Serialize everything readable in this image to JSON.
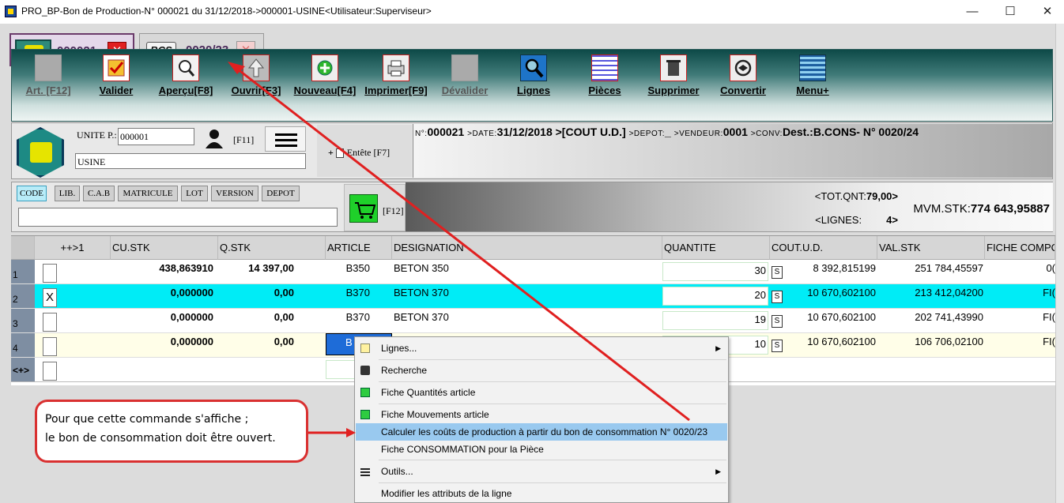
{
  "window": {
    "title": "PRO_BP-Bon de Production-N° 000021 du 31/12/2018->000001-USINE<Utilisateur:Superviseur>",
    "minimize": "—",
    "maximize": "☐",
    "close": "✕"
  },
  "doc_tabs": [
    {
      "label": "000021",
      "icon": "pro-logo-icon",
      "close": "✕"
    },
    {
      "label": "0020/23",
      "icon_text": "BCS",
      "close": "✕"
    }
  ],
  "toolbar": {
    "buttons": [
      {
        "label": "Art. [F12]",
        "icon": "blank-square-icon",
        "disabled": true
      },
      {
        "label": "Valider",
        "icon": "checkmark-icon"
      },
      {
        "label": "Aperçu[F8]",
        "icon": "magnifier-icon"
      },
      {
        "label": "Ouvrir[F3]",
        "icon": "up-arrow-icon"
      },
      {
        "label": "Nouveau[F4]",
        "icon": "plus-icon"
      },
      {
        "label": "Imprimer[F9]",
        "icon": "printer-icon"
      },
      {
        "label": "Dévalider",
        "icon": "blank-square-icon",
        "disabled": true
      },
      {
        "label": "Lignes",
        "icon": "search-lines-icon"
      },
      {
        "label": "Pièces",
        "icon": "grid-icon"
      },
      {
        "label": "Supprimer",
        "icon": "trash-icon"
      },
      {
        "label": "Convertir",
        "icon": "convert-icon"
      },
      {
        "label": "Menu+",
        "icon": "menu-lines-icon"
      }
    ]
  },
  "header": {
    "unite_label": "UNITE P.:",
    "unite_value": "000001",
    "usine_value": "USINE",
    "f11_label": "[F11]",
    "entete_label": "Entête [F7]",
    "doc_line": {
      "n_label": "N°:",
      "n_value": "000021",
      "date_label": ">DATE:",
      "date_value": "31/12/2018",
      "cout_value": ">[COUT U.D.]",
      "depot_label": ">DEPOT:",
      "depot_value": "_",
      "vendeur_label": ">VENDEUR:",
      "vendeur_value": "0001",
      "conv_label": ">CONV:",
      "conv_value": "Dest.:B.CONS- N° 0020/24"
    }
  },
  "search": {
    "tabs": [
      "CODE",
      "LIB.",
      "C.A.B",
      "MATRICULE",
      "LOT",
      "VERSION",
      "DEPOT"
    ],
    "active_tab": "CODE",
    "value": "",
    "cart_label": "[F12]"
  },
  "totals": {
    "tot_qnt_label": "<TOT.QNT:",
    "tot_qnt_value": "79,00>",
    "lignes_label": "<LIGNES:",
    "lignes_value": "4>",
    "mvm_label": "MVM.STK:",
    "mvm_value": "774 643,95887"
  },
  "grid": {
    "columns": [
      "++>1",
      "CU.STK",
      "Q.STK",
      "ARTICLE",
      "DESIGNATION",
      "QUANTITE",
      "COUT.U.D.",
      "VAL.STK",
      "FICHE COMPO"
    ],
    "rows": [
      {
        "n": "1",
        "check": "",
        "cu_stk": "438,863910",
        "q_stk": "14 397,00",
        "article": "B350",
        "designation": "BETON 350",
        "quantite": "30",
        "cout": "8 392,815199",
        "val_stk": "251 784,45597",
        "fiche": "0("
      },
      {
        "n": "2",
        "check": "X",
        "cu_stk": "0,000000",
        "q_stk": "0,00",
        "article": "B370",
        "designation": "BETON 370",
        "quantite": "20",
        "cout": "10 670,602100",
        "val_stk": "213 412,04200",
        "fiche": "FI("
      },
      {
        "n": "3",
        "check": "",
        "cu_stk": "0,000000",
        "q_stk": "0,00",
        "article": "B370",
        "designation": "BETON 370",
        "quantite": "19",
        "cout": "10 670,602100",
        "val_stk": "202 741,43990",
        "fiche": "FI("
      },
      {
        "n": "4",
        "check": "",
        "cu_stk": "0,000000",
        "q_stk": "0,00",
        "article": "B",
        "designation": "",
        "quantite": "10",
        "cout": "10 670,602100",
        "val_stk": "106 706,02100",
        "fiche": "FI("
      }
    ],
    "new_row_label": "<+>",
    "s_button": "S"
  },
  "context_menu": {
    "items": [
      {
        "label": "Lignes...",
        "icon": "document-icon",
        "submenu": true
      },
      {
        "label": "Recherche",
        "icon": "binoculars-icon"
      },
      {
        "label": "Fiche Quantités article",
        "icon": "green-m-icon"
      },
      {
        "label": "Fiche Mouvements article",
        "icon": "green-m-icon"
      },
      {
        "label": "Calculer les coûts de production à partir du bon de consommation N° 0020/23",
        "highlighted": true
      },
      {
        "label": "Fiche CONSOMMATION pour la Pièce"
      },
      {
        "label": "Outils...",
        "icon": "list-icon",
        "submenu": true
      },
      {
        "label": "Modifier les attributs de la ligne"
      }
    ]
  },
  "callout": {
    "line1": "Pour que cette commande s'affiche ;",
    "line2": "le bon de consommation doit être ouvert."
  },
  "colors": {
    "annotation_red": "#d93030",
    "selected_row": "#00ecf6",
    "menu_highlight": "#99c9ef",
    "toolbar_teal": "#0d4a48"
  }
}
